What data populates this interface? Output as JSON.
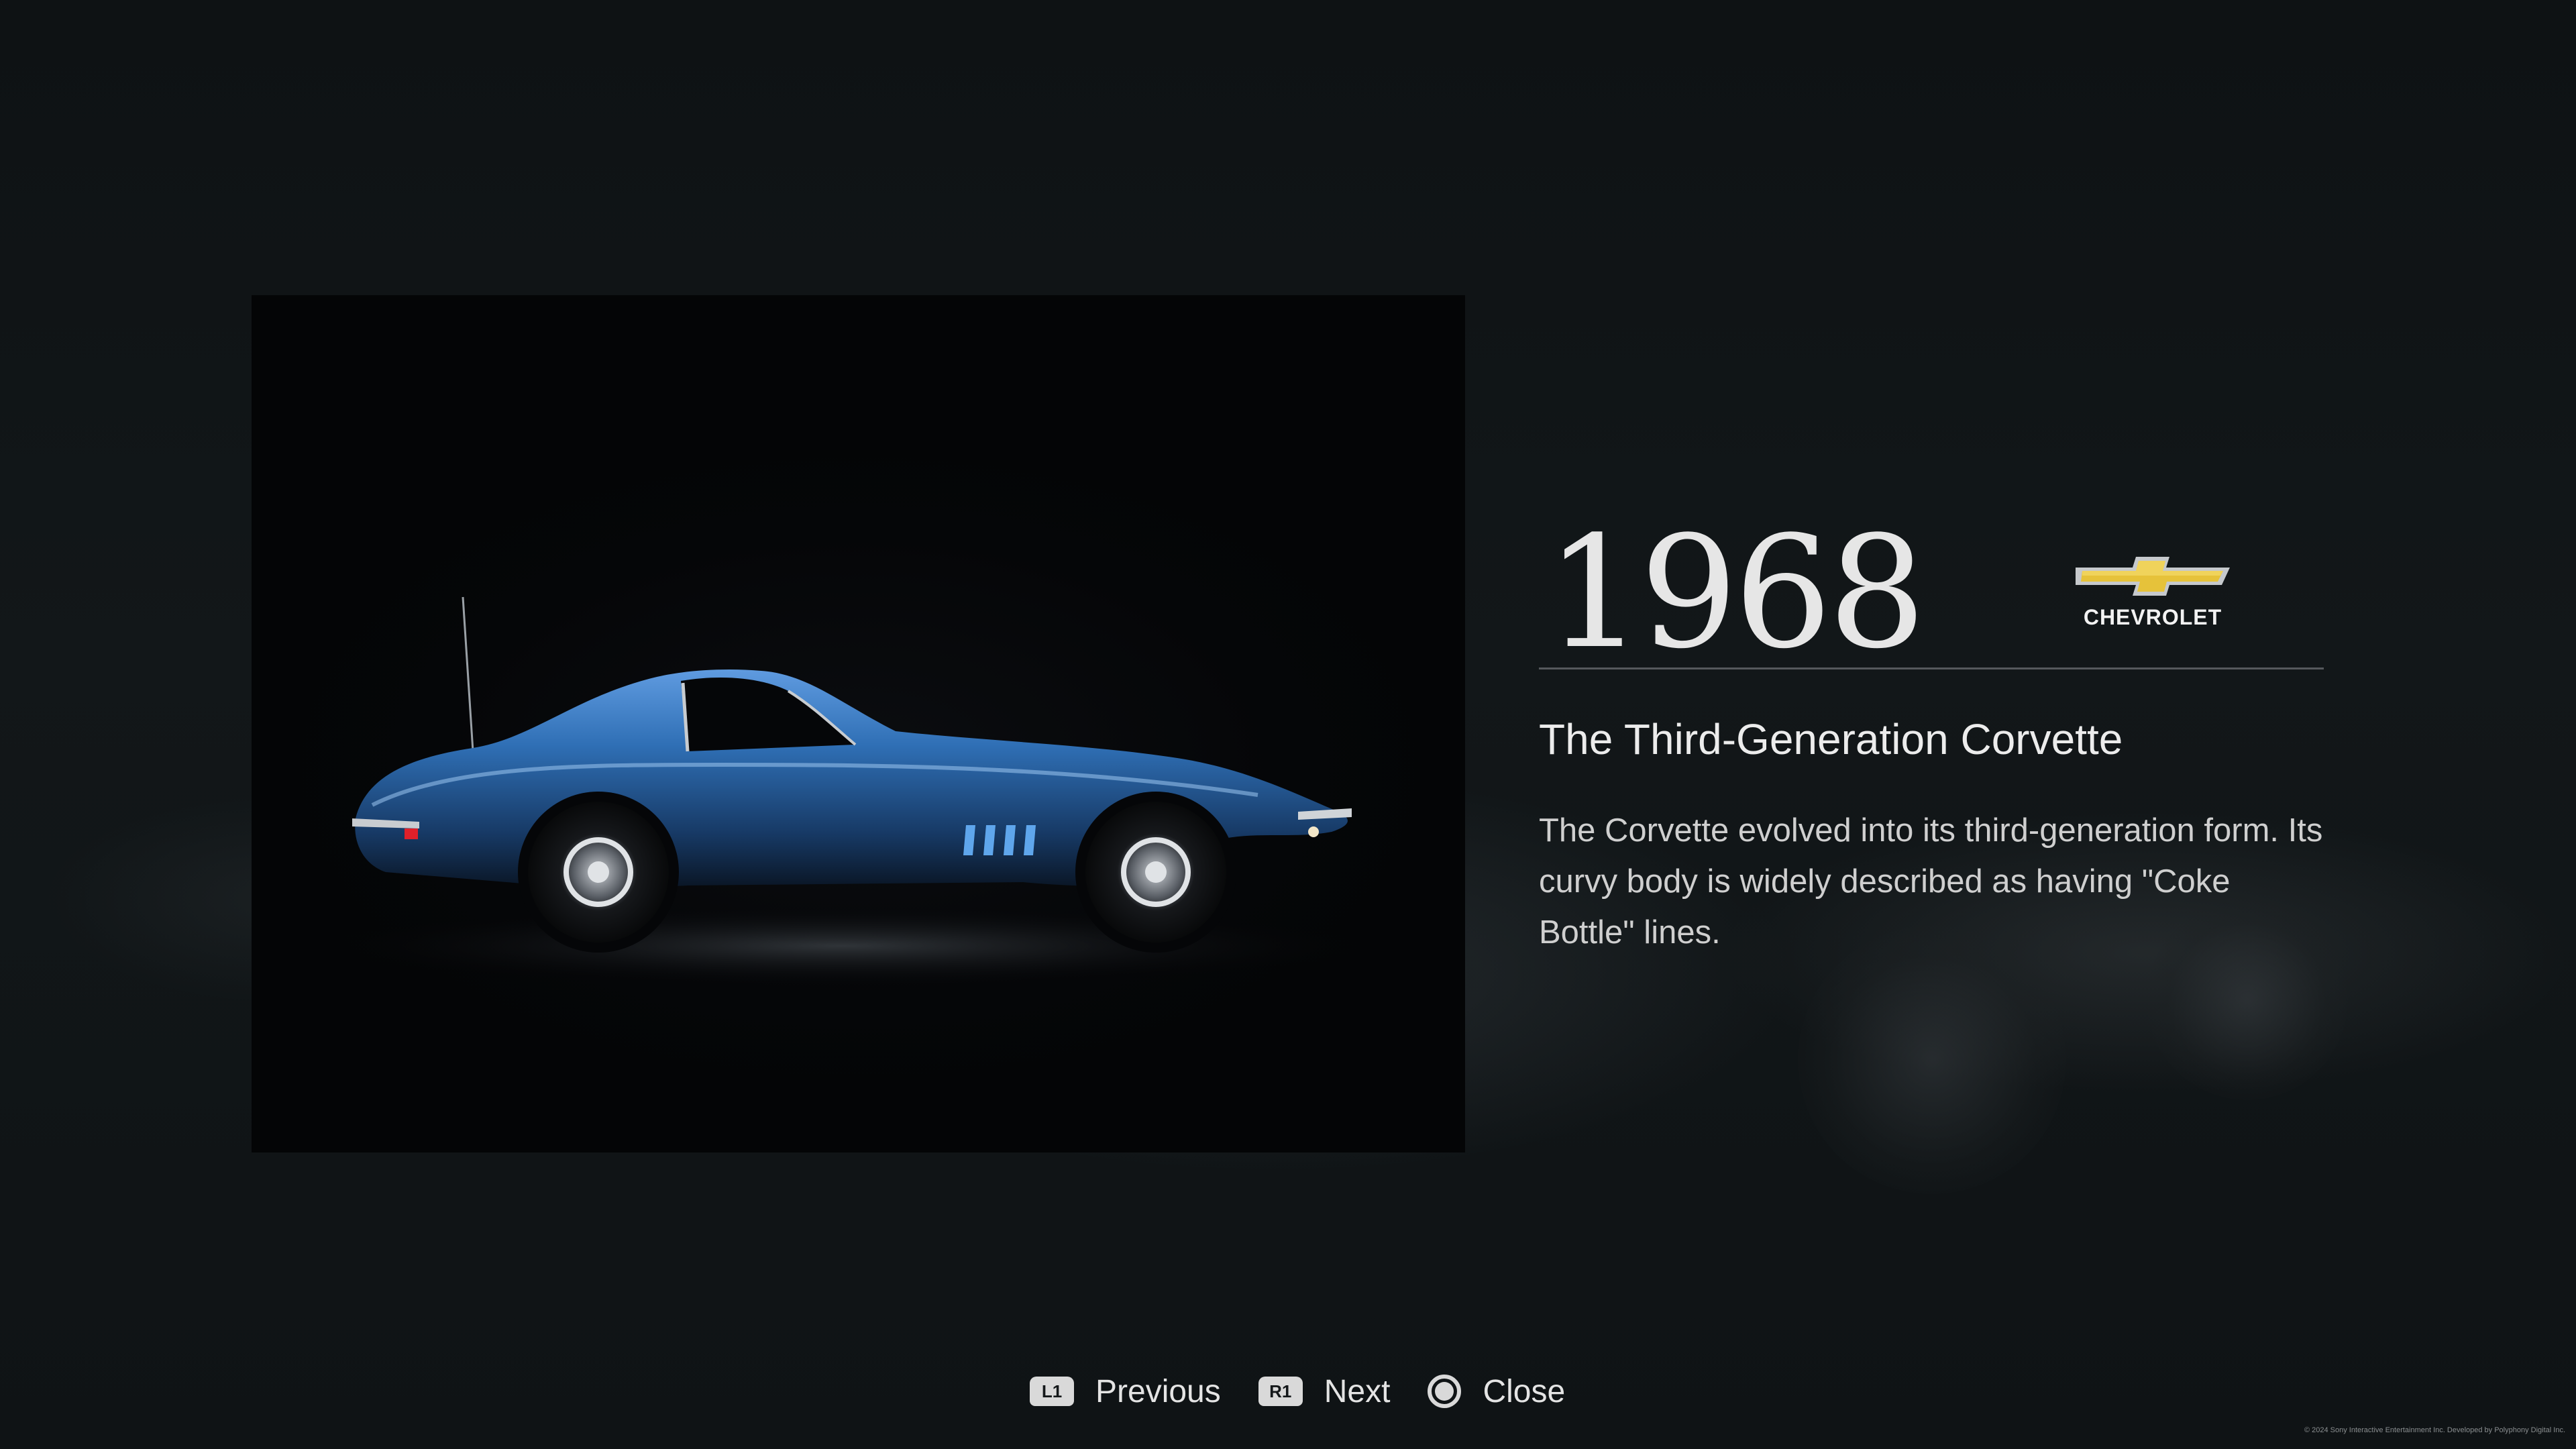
{
  "detail": {
    "year": "1968",
    "brand": {
      "name": "CHEVROLET",
      "logo_icon": "chevrolet-bowtie-icon",
      "logo_color": "#e6c23a"
    },
    "title": "The Third-Generation Corvette",
    "description": "The Corvette evolved into its third-generation form. Its curvy body is widely described as having \"Coke Bottle\" lines.",
    "photo_subject": "blue-corvette-side-profile",
    "car_color": "#2f6fb5"
  },
  "controls": {
    "previous": {
      "glyph": "L1",
      "label": "Previous"
    },
    "next": {
      "glyph": "R1",
      "label": "Next"
    },
    "close": {
      "glyph_icon": "circle-button-icon",
      "label": "Close"
    }
  },
  "footer": {
    "copyright": "© 2024 Sony Interactive Entertainment Inc. Developed by Polyphony Digital Inc."
  }
}
